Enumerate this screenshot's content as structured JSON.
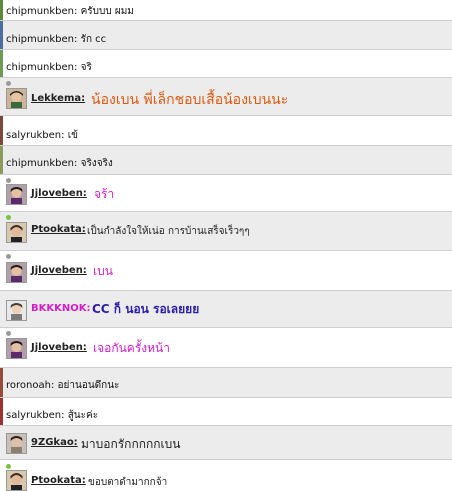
{
  "colors": {
    "row_gray": "#ececec",
    "row_white": "#ffffff",
    "orange": "#e05a10",
    "magenta": "#d21ec8",
    "purple": "#2c1ea8",
    "dark": "#222222",
    "online": "#7ac142",
    "idle": "#9a9a9a"
  },
  "messages": [
    {
      "type": "system",
      "user": "chipmunkben",
      "text": "ครับบบ ผมม"
    },
    {
      "type": "system",
      "user": "chipmunkben",
      "text": "รัก cc"
    },
    {
      "type": "system",
      "user": "chipmunkben",
      "text": "จริ"
    },
    {
      "type": "user",
      "user": "Lekkema",
      "text": "น้องเบน พี่เล็กชอบเสื้อน้องเบนนะ",
      "avatar": "avatar-boy-icon",
      "status": "idle"
    },
    {
      "type": "system",
      "user": "salyrukben",
      "text": "เข้"
    },
    {
      "type": "system",
      "user": "chipmunkben",
      "text": "จริงจริง"
    },
    {
      "type": "user",
      "user": "Jjloveben",
      "text": "จร้า",
      "avatar": "avatar-boy-icon",
      "status": "idle"
    },
    {
      "type": "user",
      "user": "Ptookata",
      "text": "เป็นกำลังใจให้เน่อ การบ้านเสร็จเร็วๆๆ",
      "avatar": "avatar-boy-icon",
      "status": "online"
    },
    {
      "type": "user",
      "user": "Jjloveben",
      "text": "เบน",
      "avatar": "avatar-boy-icon",
      "status": "idle"
    },
    {
      "type": "user",
      "user": "BKKKNOK",
      "text": "CC ก็ นอน รอเลยยย",
      "avatar": "avatar-boy-icon",
      "status": "none"
    },
    {
      "type": "user",
      "user": "Jjloveben",
      "text": "เจอกันครั้งหน้า",
      "avatar": "avatar-boy-icon",
      "status": "idle"
    },
    {
      "type": "system",
      "user": "roronoah",
      "text": "อย่านอนดึกนะ"
    },
    {
      "type": "system",
      "user": "salyrukben",
      "text": "สู้นะค่ะ"
    },
    {
      "type": "user",
      "user": "9ZGkao",
      "text": "มาบอกรักกกกกเบน",
      "avatar": "avatar-boy-icon",
      "status": "none"
    },
    {
      "type": "user",
      "user": "Ptookata",
      "text": "ขอบตาดำมากกจ้า",
      "avatar": "avatar-boy-icon",
      "status": "online"
    }
  ]
}
